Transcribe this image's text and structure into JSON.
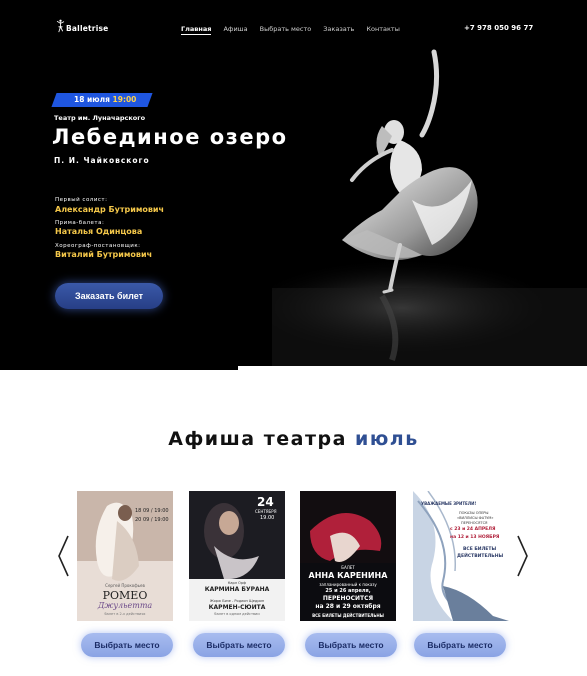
{
  "brand": {
    "name": "Balletrise"
  },
  "nav": {
    "items": [
      {
        "label": "Главная",
        "active": true
      },
      {
        "label": "Афиша",
        "active": false
      },
      {
        "label": "Выбрать место",
        "active": false
      },
      {
        "label": "Заказать",
        "active": false
      },
      {
        "label": "Контакты",
        "active": false
      }
    ],
    "phone": "+7 978 050 96 77"
  },
  "hero": {
    "date": "18 июля",
    "time": "19:00",
    "venue": "Театр им. Луначарского",
    "title": "Лебединое озеро",
    "composer": "П. И. Чайковского",
    "credits": [
      {
        "label": "Первый солист:",
        "name": "Александр Бутримович"
      },
      {
        "label": "Прима-балета:",
        "name": "Наталья Одинцова"
      },
      {
        "label": "Хореограф-постановщик:",
        "name": "Виталий Бутримович"
      }
    ],
    "buy_label": "Заказать билет"
  },
  "afisha": {
    "title_main": "Афиша театра",
    "title_accent": "июль",
    "posters": [
      {
        "lines": [
          "18",
          "09 / 19:00",
          "20",
          "09 / 19:00",
          "Сергей Прокофьев",
          "РОМЕО",
          "Джульетта",
          "балет в 2-х действиях"
        ]
      },
      {
        "lines": [
          "24",
          "СЕНТЯБРЯ",
          "19.00",
          "Карл Орф",
          "КАРМИНА БУРАНА",
          "Жорж Бизе - Родион Щедрин",
          "КАРМЕН-СЮИТА",
          "балет в одном действии"
        ]
      },
      {
        "lines": [
          "БАЛЕТ",
          "АННА КАРЕНИНА",
          "запланированный к показу",
          "25 и 26 апреля,",
          "ПЕРЕНОСИТСЯ",
          "на 28 и 29 октября",
          "ВСЕ БИЛЕТЫ ДЕЙСТВИТЕЛЬНЫ"
        ]
      },
      {
        "lines": [
          "УВАЖАЕМЫЕ ЗРИТЕЛИ!",
          "ПОКАЗЫ ОПЕРЫ",
          "«ВИЛЛИСЫ ФАТУМ»",
          "ПЕРЕНОСЯТСЯ",
          "с 23 и 24 АПРЕЛЯ",
          "на 12 и 13 НОЯБРЯ",
          "ВСЕ БИЛЕТЫ",
          "ДЕЙСТВИТЕЛЬНЫ"
        ]
      }
    ],
    "seat_label": "Выбрать место"
  },
  "colors": {
    "accent_blue": "#1f56e0",
    "accent_yellow": "#f5c84a",
    "title_accent": "#2f4f93",
    "seat_button": "#8aa3e4"
  },
  "icons": {
    "logo": "ballerina-icon",
    "prev": "chevron-left-icon",
    "next": "chevron-right-icon"
  }
}
